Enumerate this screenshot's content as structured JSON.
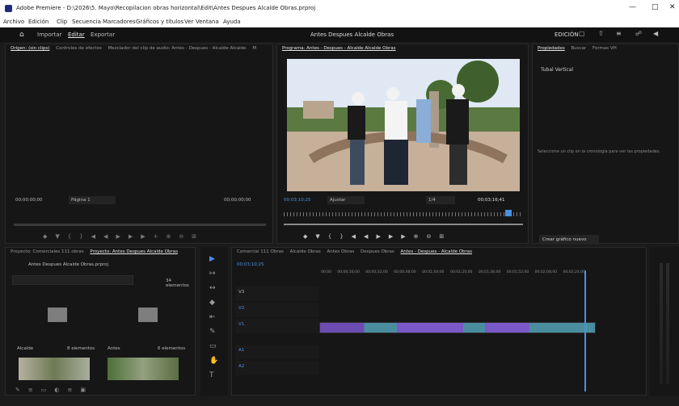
{
  "title_bar": {
    "app_title": "Adobe Premiere - D:\\2026\\5. Mayo\\Recopilacion obras horizontal\\Edit\\Antes Despues Alcalde Obras.prproj",
    "controls": [
      "—",
      "□",
      "✕"
    ]
  },
  "menu": [
    "Archivo",
    "Edición",
    "Clip",
    "Secuencia",
    "Marcadores",
    "Gráficos y títulos",
    "Ver",
    "Ventana",
    "Ayuda"
  ],
  "app_bar": {
    "tabs": [
      "Importar",
      "Editar",
      "Exportar"
    ],
    "project_name": "Antes Despues Alcalde Obras",
    "edition_label": "EDICIÓN"
  },
  "source_panel": {
    "tabs": [
      "Origen: (sin clips)",
      "Controles de efectos",
      "Mezclador del clip de audio: Antes - Despues - Alcalde Alcalde",
      "M"
    ],
    "timecode_left": "00;00;00;00",
    "fit": "Página 1",
    "timecode_right": "00;00;00;00"
  },
  "program_panel": {
    "tab": "Programa: Antes - Despues - Alcalde Alcalde Obras",
    "timecode": "00;03;10;25",
    "fit": "Ajustar",
    "quality": "1/4",
    "duration": "00;03;16;41"
  },
  "properties_panel": {
    "tabs": [
      "Propiedades",
      "Buscar",
      "Formas VH"
    ],
    "item": "Tubal Vertical",
    "message": "Seleccione un clip en la cronología para ver las propiedades.",
    "new_graphic_button": "Crear gráfico nuevo"
  },
  "project_panel": {
    "tabs": [
      "Proyecto: Comerciales 111 obras",
      "Proyecto: Antes Despues Alcalde Obras"
    ],
    "project_file": "Antes Despues Alcalde Obras.prproj",
    "item_count": "34 elementos",
    "bins": [
      {
        "name": "Alcalde",
        "count": "8 elementos"
      },
      {
        "name": "Antes",
        "count": "6 elementos"
      }
    ]
  },
  "timeline": {
    "tabs": [
      "Comercial 111 Obras",
      "Alcalde Obras",
      "Antes Obras",
      "Despues Obras",
      "Antes - Despues - Alcalde Obras"
    ],
    "timecode": "00;03;10;25",
    "ruler": [
      "00;00",
      "00;00;16;00",
      "00;00;32;00",
      "00;00;48;00",
      "00;01;04;00",
      "00;01;20;00",
      "00;01;36;00",
      "00;01;52;00",
      "00;02;08;00",
      "00;02;24;00"
    ],
    "video_tracks": [
      "V3",
      "V2",
      "V1"
    ],
    "audio_tracks": [
      "A1",
      "A2"
    ]
  }
}
